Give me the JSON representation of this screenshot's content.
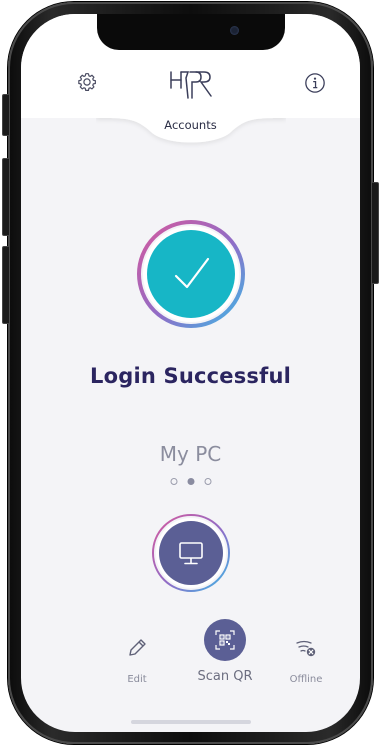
{
  "header": {
    "accounts_label": "Accounts",
    "settings_icon": "gear-icon",
    "info_icon": "info-icon",
    "logo_icon": "hypr-logo"
  },
  "status": {
    "title": "Login Successful",
    "icon": "checkmark-icon"
  },
  "device": {
    "name": "My PC",
    "pager_count": 3,
    "pager_active": 1,
    "icon": "monitor-icon"
  },
  "actions": {
    "edit_label": "Edit",
    "scan_label": "Scan QR",
    "offline_label": "Offline"
  },
  "colors": {
    "accent": "#5b5f95",
    "success": "#17b6c6",
    "title_text": "#2b2560",
    "ring_gradient_start": "#d5599e",
    "ring_gradient_end": "#3db8e6"
  }
}
